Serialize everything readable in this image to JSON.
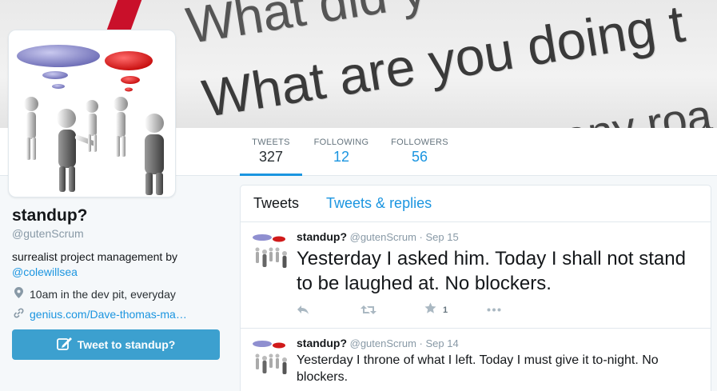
{
  "banner": {
    "line1": "What did y",
    "line2": "What are you doing t",
    "line3": "any roa"
  },
  "nav": {
    "tweets": {
      "label": "TWEETS",
      "value": "327"
    },
    "following": {
      "label": "FOLLOWING",
      "value": "12"
    },
    "followers": {
      "label": "FOLLOWERS",
      "value": "56"
    }
  },
  "profile": {
    "name": "standup?",
    "handle": "@gutenScrum",
    "bio_text": "surrealist project management by",
    "bio_link": "@colewillsea",
    "location": "10am in the dev pit, everyday",
    "website": "genius.com/Dave-thomas-ma…",
    "tweet_button": "Tweet to standup?"
  },
  "timeline": {
    "tabs": [
      "Tweets",
      "Tweets & replies"
    ],
    "tweets": [
      {
        "name": "standup?",
        "handle": "@gutenScrum",
        "dot": "·",
        "date": "Sep 15",
        "text": "Yesterday I asked him. Today I shall not stand to be laughed at. No blockers.",
        "favorites": "1"
      },
      {
        "name": "standup?",
        "handle": "@gutenScrum",
        "dot": "·",
        "date": "Sep 14",
        "text": "Yesterday I throne of what I left. Today I must give it to-night. No blockers."
      }
    ]
  },
  "icons": {
    "location": "map-pin-icon",
    "link": "link-icon",
    "compose": "compose-icon",
    "reply": "reply-icon",
    "retweet": "retweet-icon",
    "favorite": "star-icon",
    "more": "more-icon"
  },
  "colors": {
    "accent": "#1b95e0",
    "button": "#3ca0cf"
  }
}
